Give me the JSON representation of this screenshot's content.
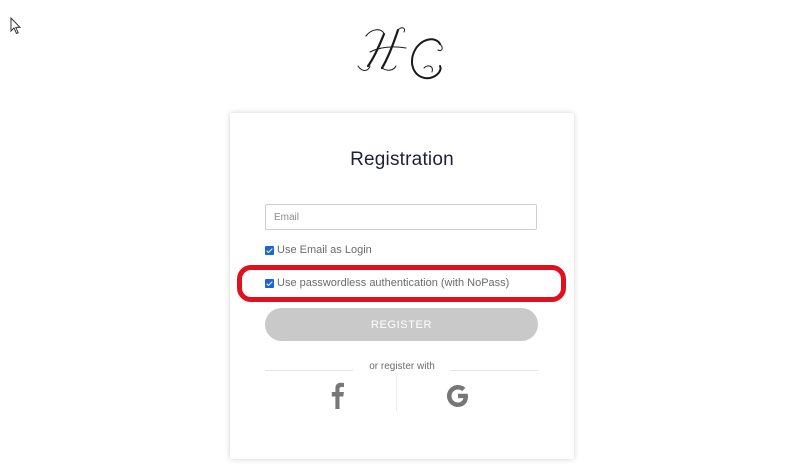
{
  "logo": {
    "monogram": "HC"
  },
  "registration": {
    "title": "Registration",
    "email_placeholder": "Email",
    "email_value": "",
    "use_email_as_login": {
      "label": "Use Email as Login",
      "checked": true
    },
    "passwordless": {
      "label": "Use passwordless authentication (with NoPass)",
      "checked": true
    },
    "register_label": "REGISTER",
    "or_register_with": "or register with"
  },
  "social": [
    "facebook-icon",
    "google-icon"
  ],
  "colors": {
    "checkbox": "#1a66d6",
    "highlight": "#e0101e",
    "register_button": "#c9c9c9",
    "social_icon": "#777777"
  }
}
